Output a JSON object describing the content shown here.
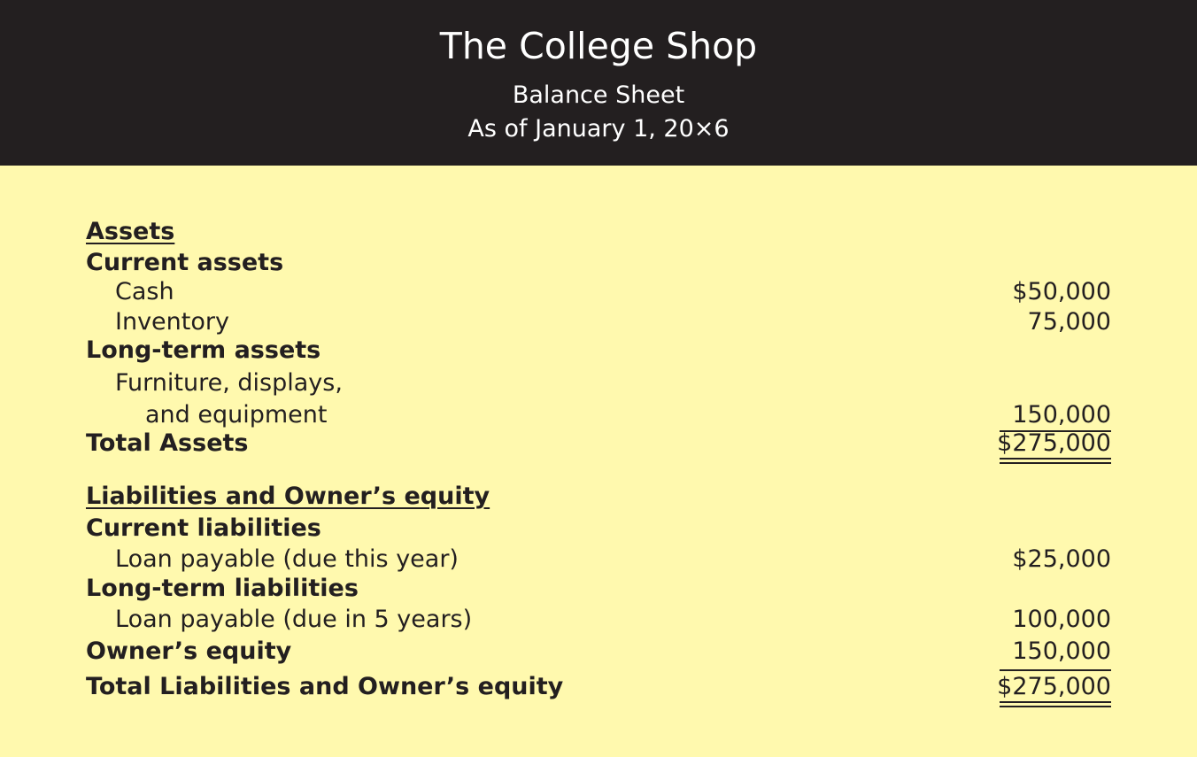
{
  "header": {
    "company": "The College Shop",
    "title": "Balance Sheet",
    "date": "As of January 1, 20×6"
  },
  "assets": {
    "heading": "Assets",
    "current_heading": "Current assets",
    "cash_label": "Cash",
    "cash_amount": "$50,000",
    "inventory_label": "Inventory",
    "inventory_amount": "75,000",
    "longterm_heading": "Long-term assets",
    "furniture_label_1": "Furniture, displays,",
    "furniture_label_2": "and equipment",
    "furniture_amount": "150,000",
    "total_label": "Total Assets",
    "total_amount": "$275,000"
  },
  "liabilities": {
    "heading": "Liabilities and Owner’s equity",
    "current_heading": "Current liabilities",
    "loan_current_label": "Loan payable (due this year)",
    "loan_current_amount": "$25,000",
    "longterm_heading": "Long-term liabilities",
    "loan_longterm_label": "Loan payable (due in 5 years)",
    "loan_longterm_amount": "100,000",
    "equity_label": "Owner’s equity",
    "equity_amount": "150,000",
    "total_label": "Total Liabilities and Owner’s equity",
    "total_amount": "$275,000"
  }
}
